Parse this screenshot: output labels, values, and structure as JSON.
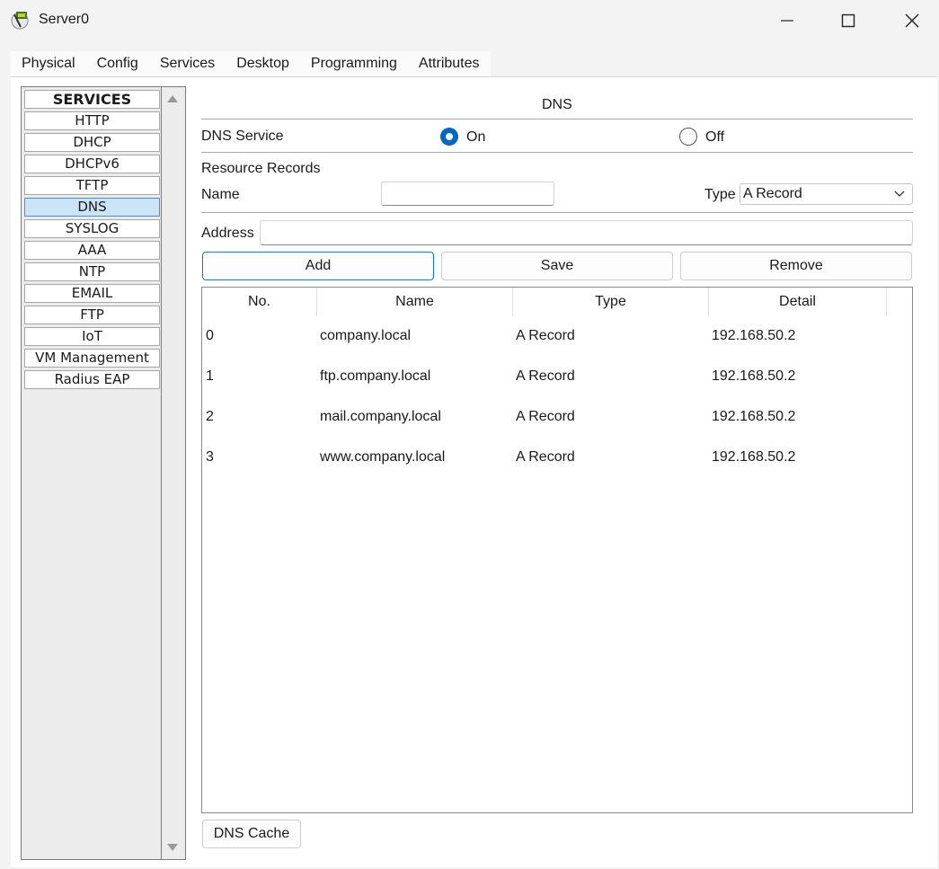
{
  "window": {
    "title": "Server0"
  },
  "tabs": [
    "Physical",
    "Config",
    "Services",
    "Desktop",
    "Programming",
    "Attributes"
  ],
  "services": {
    "header": "SERVICES",
    "items": [
      "HTTP",
      "DHCP",
      "DHCPv6",
      "TFTP",
      "DNS",
      "SYSLOG",
      "AAA",
      "NTP",
      "EMAIL",
      "FTP",
      "IoT",
      "VM Management",
      "Radius EAP"
    ],
    "selected": "DNS"
  },
  "dns": {
    "title": "DNS",
    "service_label": "DNS Service",
    "on_label": "On",
    "off_label": "Off",
    "resource_records_label": "Resource Records",
    "name_label": "Name",
    "name_value": "",
    "type_label": "Type",
    "type_value": "A Record",
    "address_label": "Address",
    "address_value": "",
    "buttons": {
      "add": "Add",
      "save": "Save",
      "remove": "Remove"
    },
    "table": {
      "columns": [
        "No.",
        "Name",
        "Type",
        "Detail"
      ],
      "rows": [
        {
          "no": "0",
          "name": "company.local",
          "type": "A Record",
          "detail": "192.168.50.2"
        },
        {
          "no": "1",
          "name": "ftp.company.local",
          "type": "A Record",
          "detail": "192.168.50.2"
        },
        {
          "no": "2",
          "name": "mail.company.local",
          "type": "A Record",
          "detail": "192.168.50.2"
        },
        {
          "no": "3",
          "name": "www.company.local",
          "type": "A Record",
          "detail": "192.168.50.2"
        }
      ]
    },
    "cache_button": "DNS Cache"
  },
  "colors": {
    "accent": "#0067c0",
    "selected_item": "#cce4f7",
    "tab_underline": "#1b2f4e"
  }
}
